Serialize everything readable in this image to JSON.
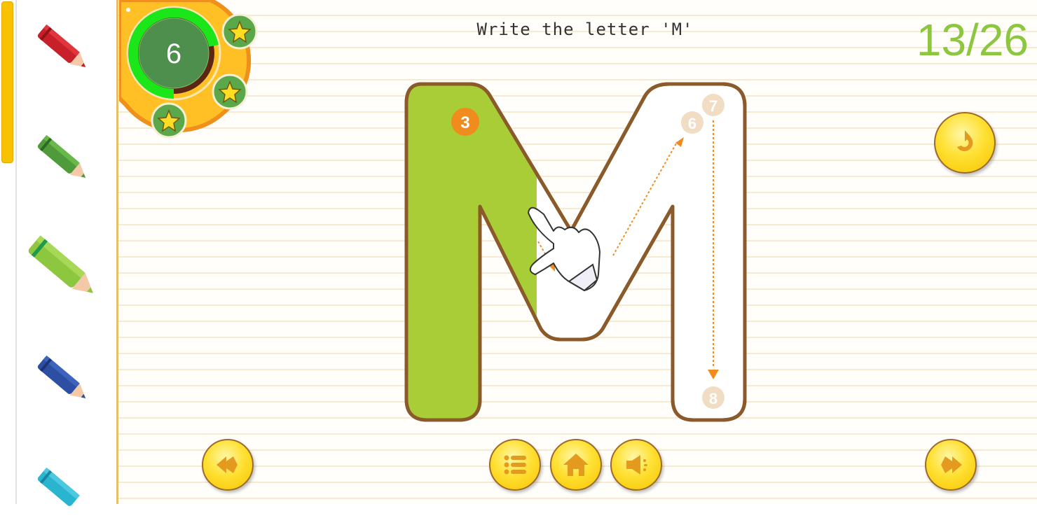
{
  "header": {
    "instruction": "Write the letter 'M'",
    "progress_counter": "13/26"
  },
  "score_badge": {
    "value": "6",
    "stars": [
      "star-1",
      "star-2",
      "star-3"
    ],
    "timer_fraction_remaining": 0.72
  },
  "sidebar": {
    "pencils": [
      {
        "name": "red",
        "color": "#c8202a"
      },
      {
        "name": "dark-green",
        "color": "#4f9a3a"
      },
      {
        "name": "light-green",
        "color": "#8dc63f",
        "selected": true
      },
      {
        "name": "blue",
        "color": "#2c4fa3"
      },
      {
        "name": "cyan",
        "color": "#29b5d0"
      }
    ]
  },
  "tracing": {
    "letter": "M",
    "fill_color": "#a8cd36",
    "step_markers": [
      "3",
      "6",
      "7",
      "8"
    ],
    "current_step": "3"
  },
  "buttons": {
    "previous": "previous-letter",
    "menu": "letter-list",
    "home": "home",
    "sound": "sound",
    "next": "next-letter",
    "replay": "replay"
  },
  "colors": {
    "accent_green": "#8dc63f",
    "button_yellow": "#ffe033",
    "outline_brown": "#8b5a2b",
    "guide_orange": "#f08c1e"
  }
}
